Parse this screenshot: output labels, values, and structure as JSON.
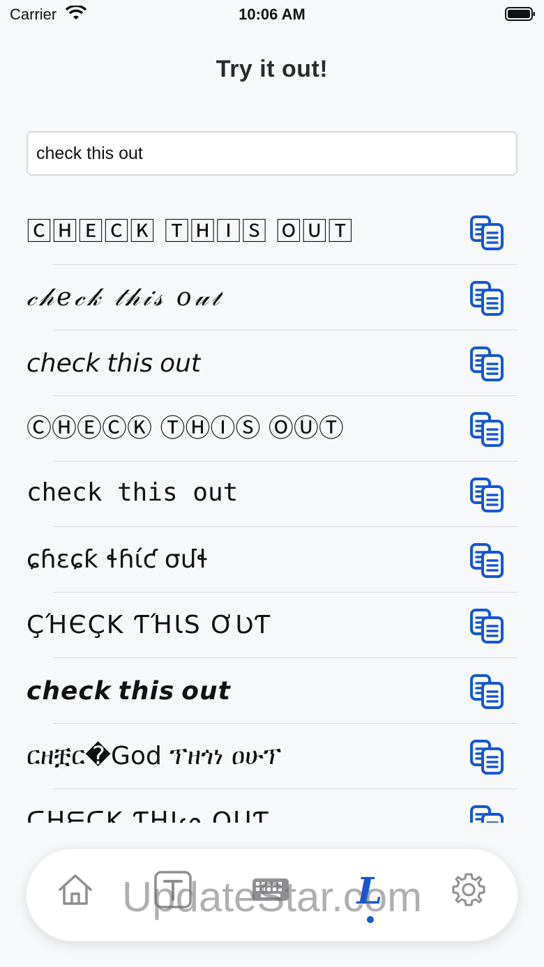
{
  "status_bar": {
    "carrier": "Carrier",
    "time": "10:06 AM"
  },
  "page": {
    "title": "Try it out!"
  },
  "search": {
    "value": "check this out",
    "placeholder": ""
  },
  "styles": [
    {
      "style": "boxed",
      "text": "🄲🄷🄴🄲🄺 🅃🄷🄸🅂 🄾🅄🅃"
    },
    {
      "style": "script",
      "text": "𝒸𝒽𝑒𝒸𝓀 𝓉𝒽𝒾𝓈 𝑜𝓊𝓉"
    },
    {
      "style": "italic",
      "text": "𝘤𝘩𝘦𝘤𝘬 𝘵𝘩𝘪𝘴 𝘰𝘶𝘵"
    },
    {
      "style": "circled",
      "text": "ⒸⒽⒺⒸⓀ ⓉⒽⒾⓈ ⓄⓊⓉ"
    },
    {
      "style": "mono",
      "text": "𝚌𝚑𝚎𝚌𝚔 𝚝𝚑𝚒𝚜 𝚘𝚞𝚝"
    },
    {
      "style": "weird",
      "text": "ɕɦɛɕƙ ɬɦίƈ σմɬ"
    },
    {
      "style": "smallcaps",
      "text": "ÇΉЄÇΚ ƬΉƖS ƠƲƬ"
    },
    {
      "style": "bolditalic",
      "text": "𝙘𝙝𝙚𝙘𝙠 𝙩𝙝𝙞𝙨 𝙤𝙪𝙩"
    },
    {
      "style": "ethiopic",
      "text": "ርዘቿር�God ፕዘጎነ ዐሁፕ"
    },
    {
      "style": "smallcaps",
      "text": "ᑕᕼᗴᑕK ƬᕼIᔕ OᑌƬ"
    }
  ],
  "tabs": [
    {
      "name": "home",
      "icon": "home-icon"
    },
    {
      "name": "text",
      "icon": "text-icon"
    },
    {
      "name": "keyboard",
      "icon": "keyboard-icon"
    },
    {
      "name": "fonts",
      "icon": "fancy-l-icon",
      "active": true
    },
    {
      "name": "settings",
      "icon": "gear-icon"
    }
  ],
  "colors": {
    "accent": "#1556d6",
    "background": "#f7f8fa",
    "inactive_icon": "#8e8e93"
  },
  "watermark": "UpdateStar.com"
}
